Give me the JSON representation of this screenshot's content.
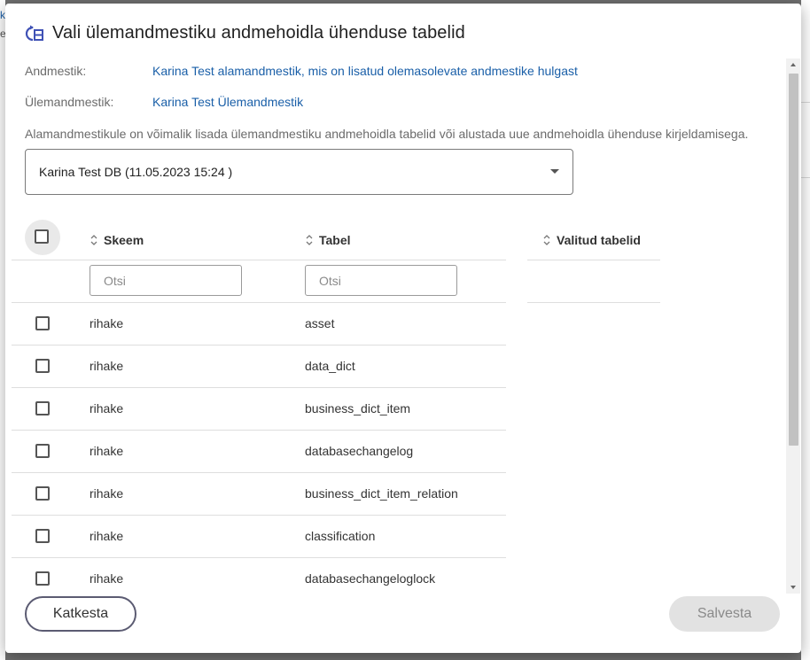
{
  "dialog": {
    "title": "Vali ülemandmestiku andmehoidla ühenduse tabelid",
    "icon": "table-sync-icon",
    "accent_color": "#3f51b5",
    "link_color": "#1a5fa8"
  },
  "info": {
    "andmestik_label": "Andmestik:",
    "andmestik_value": "Karina Test alamandmestik, mis on lisatud olemasolevate andmestike hulgast",
    "ulemandmestik_label": "Ülemandmestik:",
    "ulemandmestik_value": "Karina Test Ülemandmestik",
    "description": "Alamandmestikule on võimalik lisada ülemandmestiku andmehoidla tabelid või alustada uue andmehoidla ühenduse kirjeldamisega."
  },
  "connection_select": {
    "value": "Karina Test DB (11.05.2023 15:24 )"
  },
  "table": {
    "columns": {
      "schema": "Skeem",
      "table": "Tabel",
      "selected": "Valitud tabelid"
    },
    "filter_placeholder_schema": "Otsi",
    "filter_placeholder_table": "Otsi",
    "rows": [
      {
        "schema": "rihake",
        "table": "asset"
      },
      {
        "schema": "rihake",
        "table": "data_dict"
      },
      {
        "schema": "rihake",
        "table": "business_dict_item"
      },
      {
        "schema": "rihake",
        "table": "databasechangelog"
      },
      {
        "schema": "rihake",
        "table": "business_dict_item_relation"
      },
      {
        "schema": "rihake",
        "table": "classification"
      },
      {
        "schema": "rihake",
        "table": "databasechangeloglock"
      }
    ]
  },
  "footer": {
    "cancel_label": "Katkesta",
    "save_label": "Salvesta"
  }
}
